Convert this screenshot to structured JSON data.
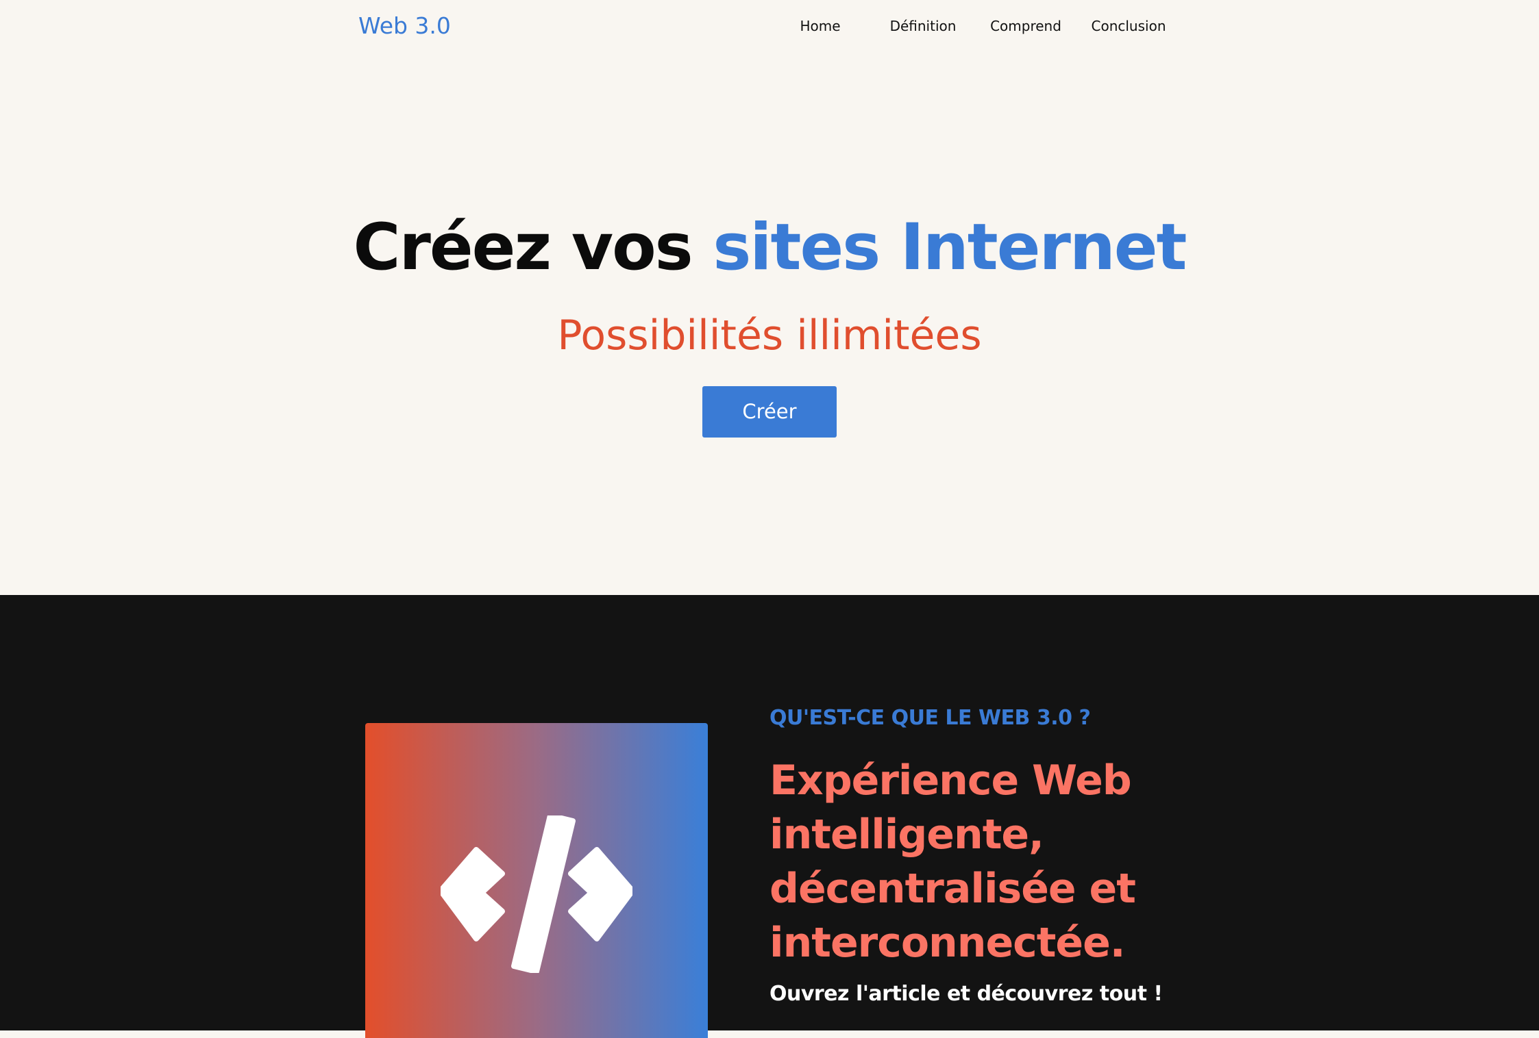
{
  "header": {
    "logo": "Web 3.0",
    "nav": [
      {
        "label": "Home"
      },
      {
        "label": "Définition"
      },
      {
        "label": "Comprend"
      },
      {
        "label": "Conclusion"
      }
    ]
  },
  "hero": {
    "title_part1": "Créez vos ",
    "title_part2": "sites Internet",
    "subtitle": "Possibilités illimitées",
    "button_label": "Créer"
  },
  "about": {
    "eyebrow": "QU'EST-CE QUE LE WEB 3.0 ?",
    "headline": "Expérience Web intelligente, décentralisée et interconnectée.",
    "tagline": "Ouvrez l'article et découvrez tout !",
    "icon": "code-icon"
  },
  "colors": {
    "accent_blue": "#3a7bd5",
    "accent_orange": "#e04e2e",
    "headline_coral": "#fb7464",
    "dark_bg": "#131313",
    "light_bg": "#f9f6f1"
  }
}
